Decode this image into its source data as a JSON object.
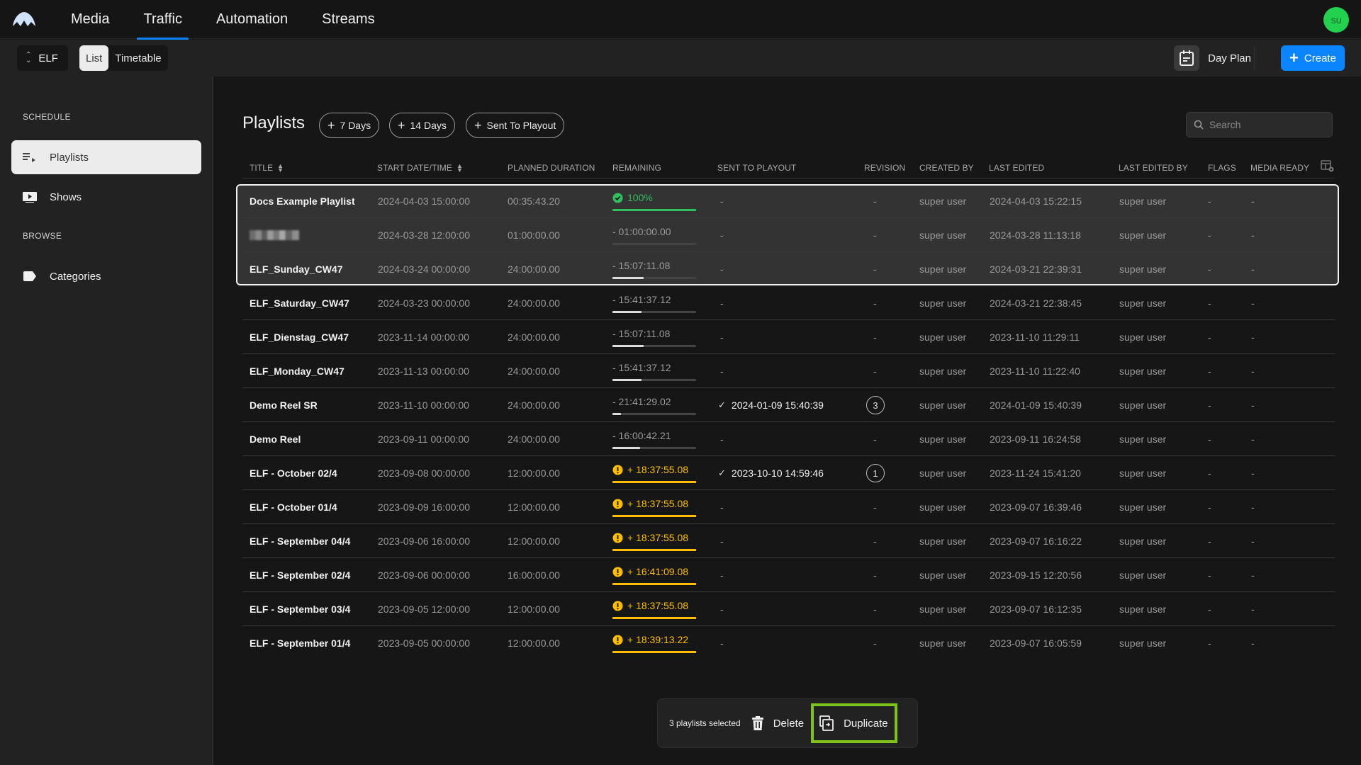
{
  "topnav": {
    "tabs": [
      {
        "label": "Media",
        "active": false
      },
      {
        "label": "Traffic",
        "active": true
      },
      {
        "label": "Automation",
        "active": false
      },
      {
        "label": "Streams",
        "active": false
      }
    ],
    "avatar_initials": "su",
    "accent_color": "#0a84ff"
  },
  "toolbar": {
    "channel": "ELF",
    "view_options": [
      "List",
      "Timetable"
    ],
    "active_view": "List",
    "day_plan_label": "Day Plan",
    "create_label": "Create"
  },
  "sidebar": {
    "sections": [
      {
        "heading": "SCHEDULE",
        "items": [
          {
            "label": "Playlists",
            "icon": "playlist-icon",
            "active": true
          },
          {
            "label": "Shows",
            "icon": "video-icon",
            "active": false
          }
        ]
      },
      {
        "heading": "BROWSE",
        "items": [
          {
            "label": "Categories",
            "icon": "tag-icon",
            "active": false
          }
        ]
      }
    ]
  },
  "main": {
    "title": "Playlists",
    "filter_chips": [
      "7 Days",
      "14 Days",
      "Sent To Playout"
    ],
    "search": {
      "placeholder": "Search",
      "value": ""
    },
    "columns": [
      "TITLE",
      "START DATE/TIME",
      "PLANNED DURATION",
      "REMAINING",
      "SENT TO PLAYOUT",
      "REVISION",
      "CREATED BY",
      "LAST EDITED",
      "LAST EDITED BY",
      "FLAGS",
      "MEDIA READY"
    ],
    "rows": [
      {
        "title": "Docs Example Playlist",
        "start": "2024-04-03 15:00:00",
        "duration": "00:35:43.20",
        "remaining": "100%",
        "remaining_status": "ok",
        "remaining_progress": 1.0,
        "sent": "-",
        "revision": "-",
        "created_by": "super user",
        "last_edited": "2024-04-03 15:22:15",
        "last_edited_by": "super user",
        "flags": "-",
        "media_ready": "-",
        "selected": true
      },
      {
        "title": "[redacted]",
        "title_redacted": true,
        "start": "2024-03-28 12:00:00",
        "duration": "01:00:00.00",
        "remaining": "- 01:00:00.00",
        "remaining_status": "under",
        "remaining_progress": 0.0,
        "sent": "-",
        "revision": "-",
        "created_by": "super user",
        "last_edited": "2024-03-28 11:13:18",
        "last_edited_by": "super user",
        "flags": "-",
        "media_ready": "-",
        "selected": true
      },
      {
        "title": "ELF_Sunday_CW47",
        "start": "2024-03-24 00:00:00",
        "duration": "24:00:00.00",
        "remaining": "- 15:07:11.08",
        "remaining_status": "under",
        "remaining_progress": 0.37,
        "sent": "-",
        "revision": "-",
        "created_by": "super user",
        "last_edited": "2024-03-21 22:39:31",
        "last_edited_by": "super user",
        "flags": "-",
        "media_ready": "-",
        "selected": true
      },
      {
        "title": "ELF_Saturday_CW47",
        "start": "2024-03-23 00:00:00",
        "duration": "24:00:00.00",
        "remaining": "- 15:41:37.12",
        "remaining_status": "under",
        "remaining_progress": 0.35,
        "sent": "-",
        "revision": "-",
        "created_by": "super user",
        "last_edited": "2024-03-21 22:38:45",
        "last_edited_by": "super user",
        "flags": "-",
        "media_ready": "-",
        "selected": false
      },
      {
        "title": "ELF_Dienstag_CW47",
        "start": "2023-11-14 00:00:00",
        "duration": "24:00:00.00",
        "remaining": "- 15:07:11.08",
        "remaining_status": "under",
        "remaining_progress": 0.37,
        "sent": "-",
        "revision": "-",
        "created_by": "super user",
        "last_edited": "2023-11-10 11:29:11",
        "last_edited_by": "super user",
        "flags": "-",
        "media_ready": "-",
        "selected": false
      },
      {
        "title": "ELF_Monday_CW47",
        "start": "2023-11-13 00:00:00",
        "duration": "24:00:00.00",
        "remaining": "- 15:41:37.12",
        "remaining_status": "under",
        "remaining_progress": 0.35,
        "sent": "-",
        "revision": "-",
        "created_by": "super user",
        "last_edited": "2023-11-10 11:22:40",
        "last_edited_by": "super user",
        "flags": "-",
        "media_ready": "-",
        "selected": false
      },
      {
        "title": "Demo Reel SR",
        "start": "2023-11-10 00:00:00",
        "duration": "24:00:00.00",
        "remaining": "- 21:41:29.02",
        "remaining_status": "under",
        "remaining_progress": 0.1,
        "sent": "2024-01-09 15:40:39",
        "sent_check": true,
        "revision": "3",
        "created_by": "super user",
        "last_edited": "2024-01-09 15:40:39",
        "last_edited_by": "super user",
        "flags": "-",
        "media_ready": "-",
        "selected": false
      },
      {
        "title": "Demo Reel",
        "start": "2023-09-11 00:00:00",
        "duration": "24:00:00.00",
        "remaining": "- 16:00:42.21",
        "remaining_status": "under",
        "remaining_progress": 0.33,
        "sent": "-",
        "revision": "-",
        "created_by": "super user",
        "last_edited": "2023-09-11 16:24:58",
        "last_edited_by": "super user",
        "flags": "-",
        "media_ready": "-",
        "selected": false
      },
      {
        "title": "ELF - October 02/4",
        "start": "2023-09-08 00:00:00",
        "duration": "12:00:00.00",
        "remaining": "+ 18:37:55.08",
        "remaining_status": "over",
        "remaining_progress": 1.0,
        "sent": "2023-10-10 14:59:46",
        "sent_check": true,
        "revision": "1",
        "created_by": "super user",
        "last_edited": "2023-11-24 15:41:20",
        "last_edited_by": "super user",
        "flags": "-",
        "media_ready": "-",
        "selected": false
      },
      {
        "title": "ELF - October 01/4",
        "start": "2023-09-09 16:00:00",
        "duration": "12:00:00.00",
        "remaining": "+ 18:37:55.08",
        "remaining_status": "over",
        "remaining_progress": 1.0,
        "sent": "-",
        "revision": "-",
        "created_by": "super user",
        "last_edited": "2023-09-07 16:39:46",
        "last_edited_by": "super user",
        "flags": "-",
        "media_ready": "-",
        "selected": false
      },
      {
        "title": "ELF - September 04/4",
        "start": "2023-09-06 16:00:00",
        "duration": "12:00:00.00",
        "remaining": "+ 18:37:55.08",
        "remaining_status": "over",
        "remaining_progress": 1.0,
        "sent": "-",
        "revision": "-",
        "created_by": "super user",
        "last_edited": "2023-09-07 16:16:22",
        "last_edited_by": "super user",
        "flags": "-",
        "media_ready": "-",
        "selected": false
      },
      {
        "title": "ELF - September 02/4",
        "start": "2023-09-06 00:00:00",
        "duration": "16:00:00.00",
        "remaining": "+ 16:41:09.08",
        "remaining_status": "over",
        "remaining_progress": 1.0,
        "sent": "-",
        "revision": "-",
        "created_by": "super user",
        "last_edited": "2023-09-15 12:20:56",
        "last_edited_by": "super user",
        "flags": "-",
        "media_ready": "-",
        "selected": false
      },
      {
        "title": "ELF - September 03/4",
        "start": "2023-09-05 12:00:00",
        "duration": "12:00:00.00",
        "remaining": "+ 18:37:55.08",
        "remaining_status": "over",
        "remaining_progress": 1.0,
        "sent": "-",
        "revision": "-",
        "created_by": "super user",
        "last_edited": "2023-09-07 16:12:35",
        "last_edited_by": "super user",
        "flags": "-",
        "media_ready": "-",
        "selected": false
      },
      {
        "title": "ELF - September 01/4",
        "start": "2023-09-05 00:00:00",
        "duration": "12:00:00.00",
        "remaining": "+ 18:39:13.22",
        "remaining_status": "over",
        "remaining_progress": 1.0,
        "sent": "-",
        "revision": "-",
        "created_by": "super user",
        "last_edited": "2023-09-07 16:05:59",
        "last_edited_by": "super user",
        "flags": "-",
        "media_ready": "-",
        "selected": false
      }
    ]
  },
  "action_bar": {
    "selection_text": "3 playlists selected",
    "delete_label": "Delete",
    "duplicate_label": "Duplicate",
    "highlight_color": "#7cc518"
  },
  "status_colors": {
    "ok": "#2fbf5f",
    "warn": "#ffbf00"
  }
}
